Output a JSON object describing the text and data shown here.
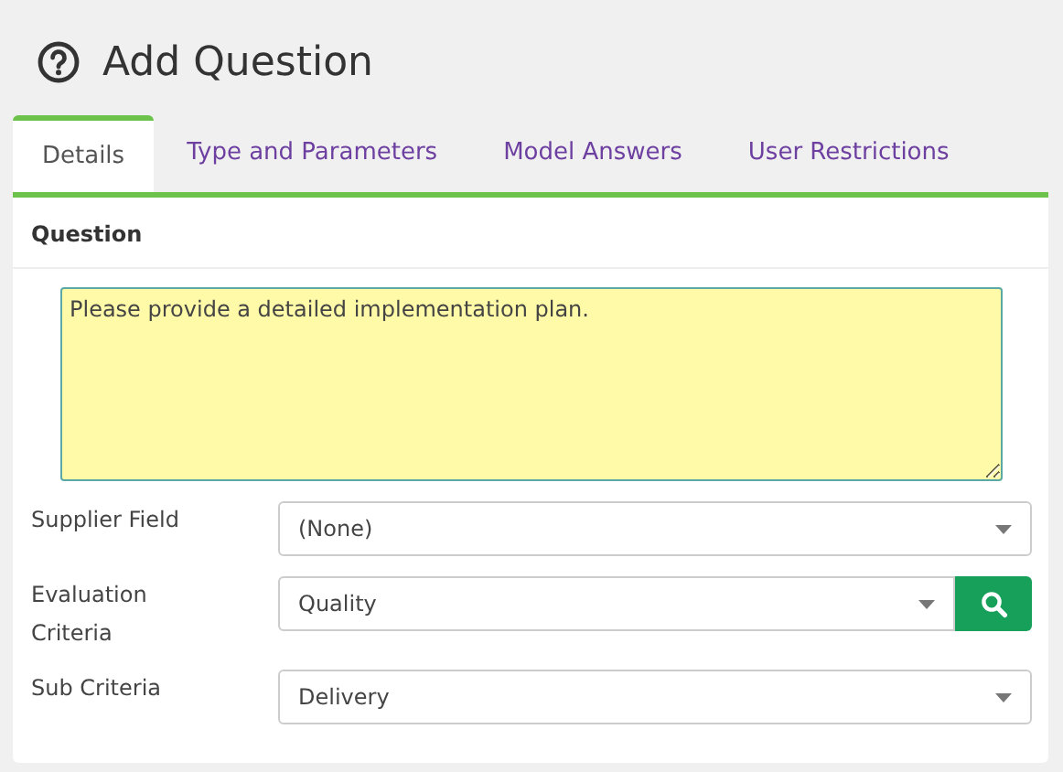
{
  "title": "Add Question",
  "tabs": [
    {
      "label": "Details",
      "selected": true
    },
    {
      "label": "Type and Parameters",
      "selected": false
    },
    {
      "label": "Model Answers",
      "selected": false
    },
    {
      "label": "User Restrictions",
      "selected": false
    }
  ],
  "section": {
    "heading": "Question",
    "question_text": "Please provide a detailed implementation plan."
  },
  "fields": [
    {
      "label": "Supplier Field",
      "value": "(None)",
      "search_button": false
    },
    {
      "label": "Evaluation Criteria",
      "value": "Quality",
      "search_button": true
    },
    {
      "label": "Sub Criteria",
      "value": "Delivery",
      "search_button": false
    }
  ]
}
